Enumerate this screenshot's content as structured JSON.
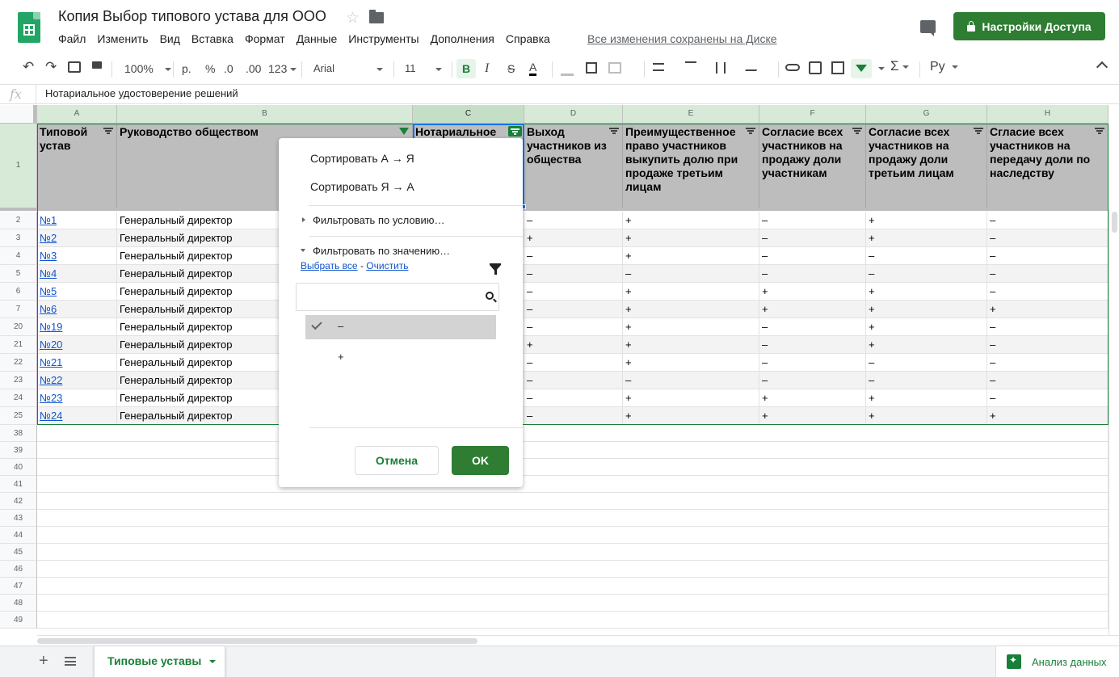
{
  "doc": {
    "title": "Копия Выбор типового устава для ООО",
    "saved_status": "Все изменения сохранены на Диске"
  },
  "menu": [
    "Файл",
    "Изменить",
    "Вид",
    "Вставка",
    "Формат",
    "Данные",
    "Инструменты",
    "Дополнения",
    "Справка"
  ],
  "share": {
    "label": "Настройки Доступа"
  },
  "toolbar": {
    "zoom": "100%",
    "currency": "р.",
    "percent": "%",
    "dec_minus": ".0",
    "dec_plus": ".00",
    "format": "123",
    "font": "Arial",
    "size": "11",
    "bold": "B",
    "italic": "I",
    "strike": "S",
    "text_color": "A",
    "function": "Σ",
    "input_lang": "Ру"
  },
  "formula_bar": {
    "fx": "fx",
    "value": "Нотариальное удостоверение решений"
  },
  "columns": [
    "A",
    "B",
    "C",
    "D",
    "E",
    "F",
    "G",
    "H"
  ],
  "header_row": {
    "number": "1",
    "cells": [
      "Типовой устав",
      "Руководство обществом",
      "Нотариальное",
      "Выход участников из общества",
      "Преимущественное право участников выкупить долю при продаже третьим лицам",
      "Согласие всех участников на продажу доли участникам",
      "Согласие всех участников на продажу доли третьим лицам",
      "Сгласие всех участников на передачу доли по наследству"
    ]
  },
  "rows": [
    {
      "n": "2",
      "a": "№1",
      "b": "Генеральный директор",
      "d": "–",
      "e": "+",
      "f": "–",
      "g": "+",
      "h": "–"
    },
    {
      "n": "3",
      "a": "№2",
      "b": "Генеральный директор",
      "d": "+",
      "e": "+",
      "f": "–",
      "g": "+",
      "h": "–"
    },
    {
      "n": "4",
      "a": "№3",
      "b": "Генеральный директор",
      "d": "–",
      "e": "+",
      "f": "–",
      "g": "–",
      "h": "–"
    },
    {
      "n": "5",
      "a": "№4",
      "b": "Генеральный директор",
      "d": "–",
      "e": "–",
      "f": "–",
      "g": "–",
      "h": "–"
    },
    {
      "n": "6",
      "a": "№5",
      "b": "Генеральный директор",
      "d": "–",
      "e": "+",
      "f": "+",
      "g": "+",
      "h": "–"
    },
    {
      "n": "7",
      "a": "№6",
      "b": "Генеральный директор",
      "d": "–",
      "e": "+",
      "f": "+",
      "g": "+",
      "h": "+"
    },
    {
      "n": "20",
      "a": "№19",
      "b": "Генеральный директор",
      "d": "–",
      "e": "+",
      "f": "–",
      "g": "+",
      "h": "–"
    },
    {
      "n": "21",
      "a": "№20",
      "b": "Генеральный директор",
      "d": "+",
      "e": "+",
      "f": "–",
      "g": "+",
      "h": "–"
    },
    {
      "n": "22",
      "a": "№21",
      "b": "Генеральный директор",
      "d": "–",
      "e": "+",
      "f": "–",
      "g": "–",
      "h": "–"
    },
    {
      "n": "23",
      "a": "№22",
      "b": "Генеральный директор",
      "d": "–",
      "e": "–",
      "f": "–",
      "g": "–",
      "h": "–"
    },
    {
      "n": "24",
      "a": "№23",
      "b": "Генеральный директор",
      "d": "–",
      "e": "+",
      "f": "+",
      "g": "+",
      "h": "–"
    },
    {
      "n": "25",
      "a": "№24",
      "b": "Генеральный директор",
      "d": "–",
      "e": "+",
      "f": "+",
      "g": "+",
      "h": "+"
    }
  ],
  "empty_rows": [
    "38",
    "39",
    "40",
    "41",
    "42",
    "43",
    "44",
    "45",
    "46",
    "47",
    "48",
    "49"
  ],
  "filter_popup": {
    "sort_az": "Сортировать А → Я",
    "sort_za": "Сортировать Я → А",
    "by_condition": "Фильтровать по условию…",
    "by_value": "Фильтровать по значению…",
    "select_all": "Выбрать все",
    "dash": "-",
    "clear": "Очистить",
    "values": [
      "–",
      "+"
    ],
    "cancel": "Отмена",
    "ok": "OK"
  },
  "sheet": {
    "tab_name": "Типовые уставы"
  },
  "explore": {
    "label": "Анализ данных"
  },
  "colors": {
    "green": "#188038",
    "header_bg": "#bdbdbd",
    "link": "#1155cc",
    "button_green": "#2e7d32"
  }
}
